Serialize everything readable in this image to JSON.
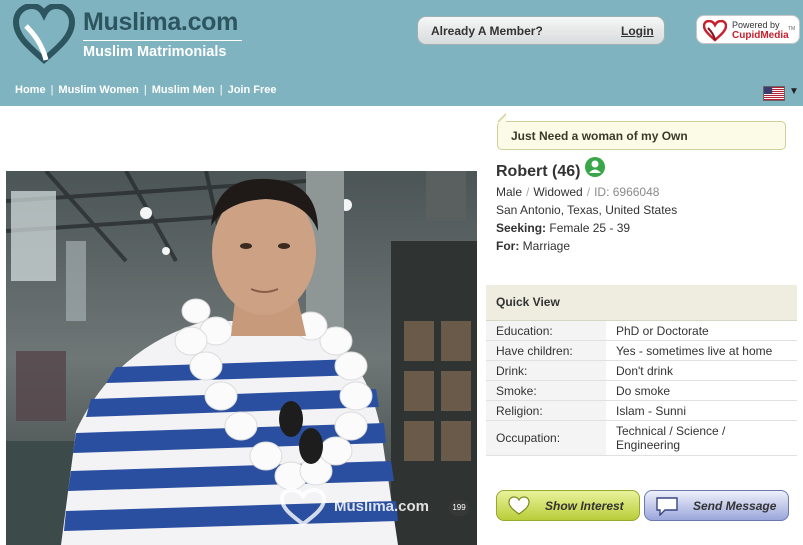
{
  "brand": {
    "title": "Muslima.com",
    "subtitle": "Muslim Matrimonials"
  },
  "member": {
    "prompt": "Already A Member?",
    "login_label": "Login"
  },
  "partner": {
    "powered_by": "Powered by",
    "name": "CupidMedia",
    "tm": "TM"
  },
  "nav": {
    "items": [
      "Home",
      "Muslim Women",
      "Muslim Men",
      "Join Free"
    ],
    "separator": "|"
  },
  "language": {
    "flag_icon": "us-flag-icon",
    "arrow": "▼"
  },
  "profile": {
    "headline": "Just Need a woman of my Own",
    "name_age": "Robert (46)",
    "gender": "Male",
    "status": "Widowed",
    "id_text": "ID: 6966048",
    "location": "San Antonio, Texas, United States",
    "seeking_label": "Seeking:",
    "seeking_value": "Female 25 - 39",
    "for_label": "For:",
    "for_value": "Marriage"
  },
  "photo": {
    "watermark": "Muslima.com",
    "counter": "199"
  },
  "quick_view": {
    "title": "Quick View",
    "rows": [
      {
        "label": "Education:",
        "value": "PhD or Doctorate"
      },
      {
        "label": "Have children:",
        "value": "Yes - sometimes live at home"
      },
      {
        "label": "Drink:",
        "value": "Don't drink"
      },
      {
        "label": "Smoke:",
        "value": "Do smoke"
      },
      {
        "label": "Religion:",
        "value": "Islam - Sunni"
      },
      {
        "label": "Occupation:",
        "value": "Technical / Science / Engineering"
      }
    ]
  },
  "actions": {
    "show_interest": "Show Interest",
    "send_message": "Send Message"
  },
  "colors": {
    "header_bg": "#7fb3bf",
    "brand_dark": "#2d5560",
    "interest_green": "#b9cd3a",
    "message_blue": "#9aa6da"
  }
}
